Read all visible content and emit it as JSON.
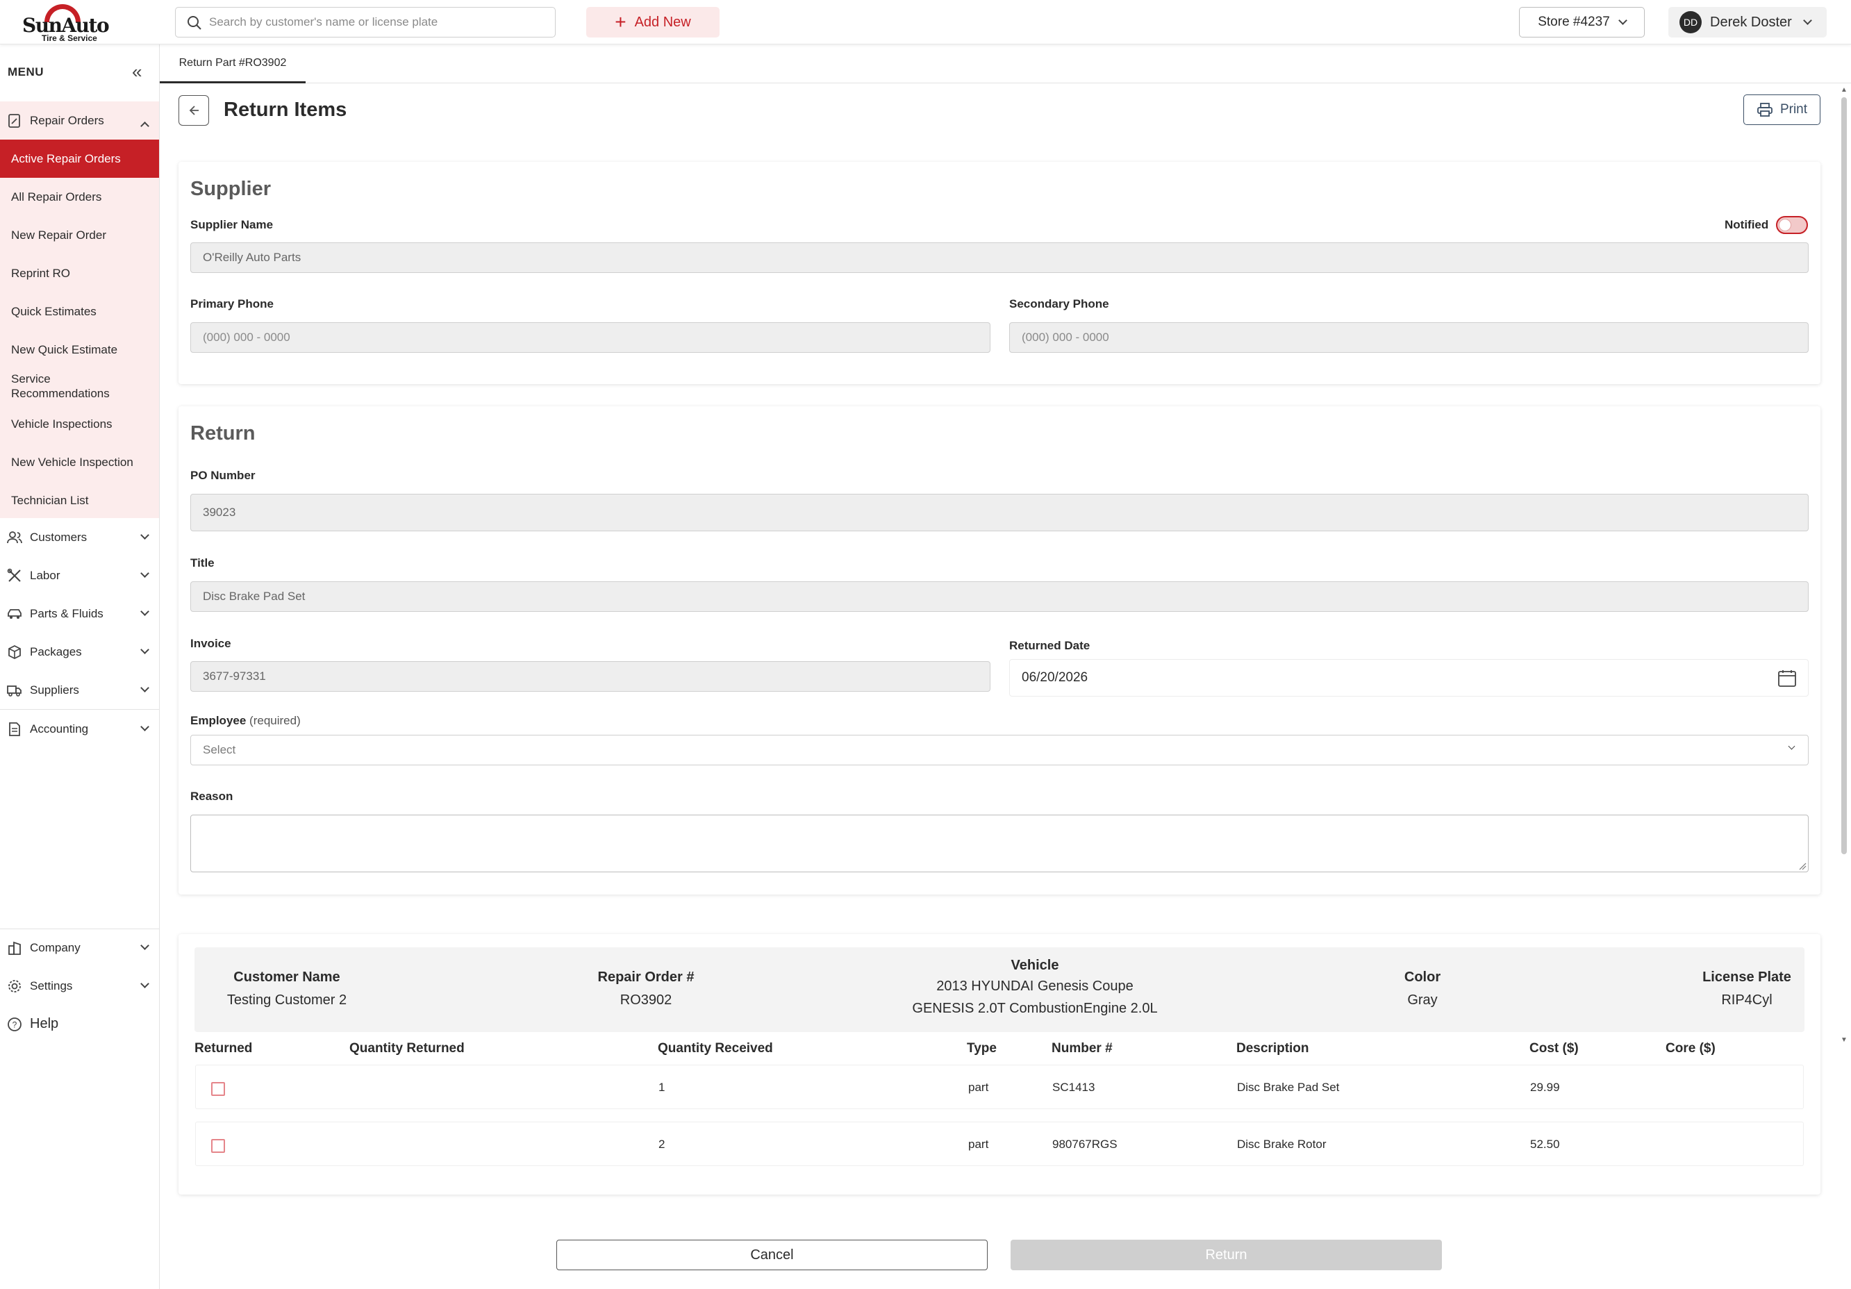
{
  "brand": {
    "name": "SunAuto",
    "tagline": "Tire & Service"
  },
  "header": {
    "search_placeholder": "Search by customer's name or license plate",
    "add_new": "Add New",
    "store": "Store #4237",
    "user_initials": "DD",
    "user_name": "Derek Doster"
  },
  "sidebar": {
    "menu_label": "MENU",
    "repair_orders": "Repair Orders",
    "sub_items": [
      "Active Repair Orders",
      "All Repair Orders",
      "New Repair Order",
      "Reprint RO",
      "Quick Estimates",
      "New Quick Estimate",
      "Service Recommendations",
      "Vehicle Inspections",
      "New Vehicle Inspection",
      "Technician List"
    ],
    "sections": [
      "Customers",
      "Labor",
      "Parts & Fluids",
      "Packages",
      "Suppliers",
      "Accounting"
    ],
    "bottom": [
      "Company",
      "Settings",
      "Help"
    ]
  },
  "tab": {
    "label": "Return Part #RO3902"
  },
  "page": {
    "title": "Return Items",
    "print": "Print"
  },
  "supplier": {
    "heading": "Supplier",
    "name_label": "Supplier Name",
    "name_value": "O'Reilly Auto Parts",
    "notified_label": "Notified",
    "notified": false,
    "primary_label": "Primary Phone",
    "primary_placeholder": "(000) 000 - 0000",
    "secondary_label": "Secondary Phone",
    "secondary_placeholder": "(000) 000 - 0000"
  },
  "return": {
    "heading": "Return",
    "po_label": "PO Number",
    "po_value": "39023",
    "title_label": "Title",
    "title_value": "Disc Brake Pad Set",
    "invoice_label": "Invoice",
    "invoice_value": "3677-97331",
    "date_label": "Returned Date",
    "date_value": "06/20/2026",
    "employee_label": "Employee",
    "employee_required": "(required)",
    "employee_placeholder": "Select",
    "reason_label": "Reason"
  },
  "info": {
    "customer_label": "Customer Name",
    "customer_value": "Testing Customer 2",
    "ro_label": "Repair Order #",
    "ro_value": "RO3902",
    "vehicle_label": "Vehicle",
    "vehicle_line1": "2013 HYUNDAI Genesis Coupe",
    "vehicle_line2": "GENESIS 2.0T CombustionEngine 2.0L",
    "color_label": "Color",
    "color_value": "Gray",
    "plate_label": "License Plate",
    "plate_value": "RIP4Cyl"
  },
  "table": {
    "headers": [
      "Returned",
      "Quantity Returned",
      "Quantity Received",
      "Type",
      "Number #",
      "Description",
      "Cost ($)",
      "Core ($)"
    ],
    "rows": [
      {
        "qty_received": "1",
        "type": "part",
        "number": "SC1413",
        "description": "Disc Brake Pad Set",
        "cost": "29.99",
        "core": ""
      },
      {
        "qty_received": "2",
        "type": "part",
        "number": "980767RGS",
        "description": "Disc Brake Rotor",
        "cost": "52.50",
        "core": ""
      }
    ]
  },
  "actions": {
    "cancel": "Cancel",
    "return": "Return"
  },
  "colors": {
    "accent": "#c62026",
    "accent_light": "#fcecec"
  }
}
